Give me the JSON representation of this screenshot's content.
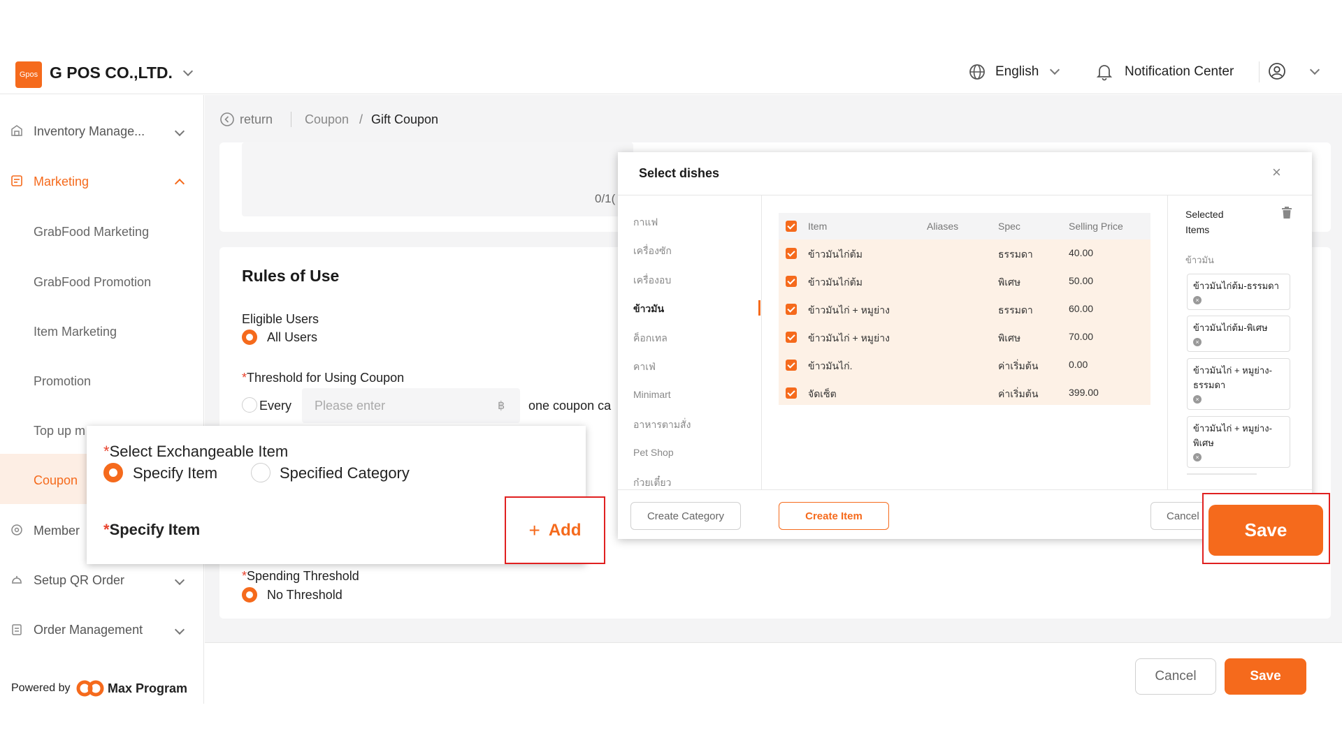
{
  "header": {
    "logo_text": "Gpos",
    "company": "G POS CO.,LTD.",
    "language": "English",
    "notification": "Notification Center"
  },
  "sidebar": {
    "items": [
      {
        "label": "Inventory Manage..."
      },
      {
        "label": "Marketing"
      },
      {
        "label": "GrabFood Marketing"
      },
      {
        "label": "GrabFood Promotion"
      },
      {
        "label": "Item Marketing"
      },
      {
        "label": "Promotion"
      },
      {
        "label": "Top up m"
      },
      {
        "label": "Coupon"
      },
      {
        "label": "Member"
      },
      {
        "label": "Setup QR Order"
      },
      {
        "label": "Order Management"
      }
    ],
    "powered_by": "Powered by",
    "powered_brand": "Max Program"
  },
  "breadcrumb": {
    "return": "return",
    "coupon": "Coupon",
    "sep": "/",
    "current": "Gift Coupon"
  },
  "form": {
    "counter": "0/1(",
    "rules_title": "Rules of Use",
    "eligible_label": "Eligible Users",
    "eligible_value": "All Users",
    "threshold_label": "Threshold for Using Coupon",
    "threshold_every": "Every",
    "threshold_placeholder": "Please enter",
    "currency": "฿",
    "threshold_suffix": "one coupon ca",
    "spending_label": "Spending Threshold",
    "spending_value": "No Threshold",
    "required_mark": "*"
  },
  "overlay": {
    "select_label": "Select Exchangeable Item",
    "opt_specify": "Specify Item",
    "opt_category": "Specified Category",
    "specify_label": "Specify Item",
    "add_label": "Add",
    "add_symbol": "+"
  },
  "dialog": {
    "title": "Select dishes",
    "close": "×",
    "categories": [
      "กาแฟ",
      "เครื่องซัก",
      "เครื่องอบ",
      "ข้าวมัน",
      "ค็อกเทล",
      "คาเฟ่",
      "Minimart",
      "อาหารตามสั่ง",
      "Pet Shop",
      "ก๋วยเตี๋ยว"
    ],
    "active_category": "ข้าวมัน",
    "columns": [
      "Item",
      "Aliases",
      "Spec",
      "Selling Price"
    ],
    "rows": [
      {
        "item": "ข้าวมันไก่ต้ม",
        "alias": "",
        "spec": "ธรรมดา",
        "price": "40.00"
      },
      {
        "item": "ข้าวมันไก่ต้ม",
        "alias": "",
        "spec": "พิเศษ",
        "price": "50.00"
      },
      {
        "item": "ข้าวมันไก่ + หมูย่าง",
        "alias": "",
        "spec": "ธรรมดา",
        "price": "60.00"
      },
      {
        "item": "ข้าวมันไก่ + หมูย่าง",
        "alias": "",
        "spec": "พิเศษ",
        "price": "70.00"
      },
      {
        "item": "ข้าวมันไก่.",
        "alias": "",
        "spec": "ค่าเริ่มต้น",
        "price": "0.00"
      },
      {
        "item": "จัดเซ็ต",
        "alias": "",
        "spec": "ค่าเริ่มต้น",
        "price": "399.00"
      }
    ],
    "selected_title": "Selected Items",
    "selected_group": "ข้าวมัน",
    "selected_chips": [
      "ข้าวมันไก่ต้ม-ธรรมดา",
      "ข้าวมันไก่ต้ม-พิเศษ",
      "ข้าวมันไก่ + หมูย่าง-ธรรมดา",
      "ข้าวมันไก่ + หมูย่าง-พิเศษ"
    ],
    "create_category": "Create Category",
    "create_item": "Create Item",
    "cancel": "Cancel",
    "save": "Save"
  },
  "footer": {
    "cancel": "Cancel",
    "save": "Save"
  },
  "colors": {
    "accent": "#f56a1c",
    "highlight_row": "#fdf1e6",
    "annotation_red": "#e02020"
  }
}
